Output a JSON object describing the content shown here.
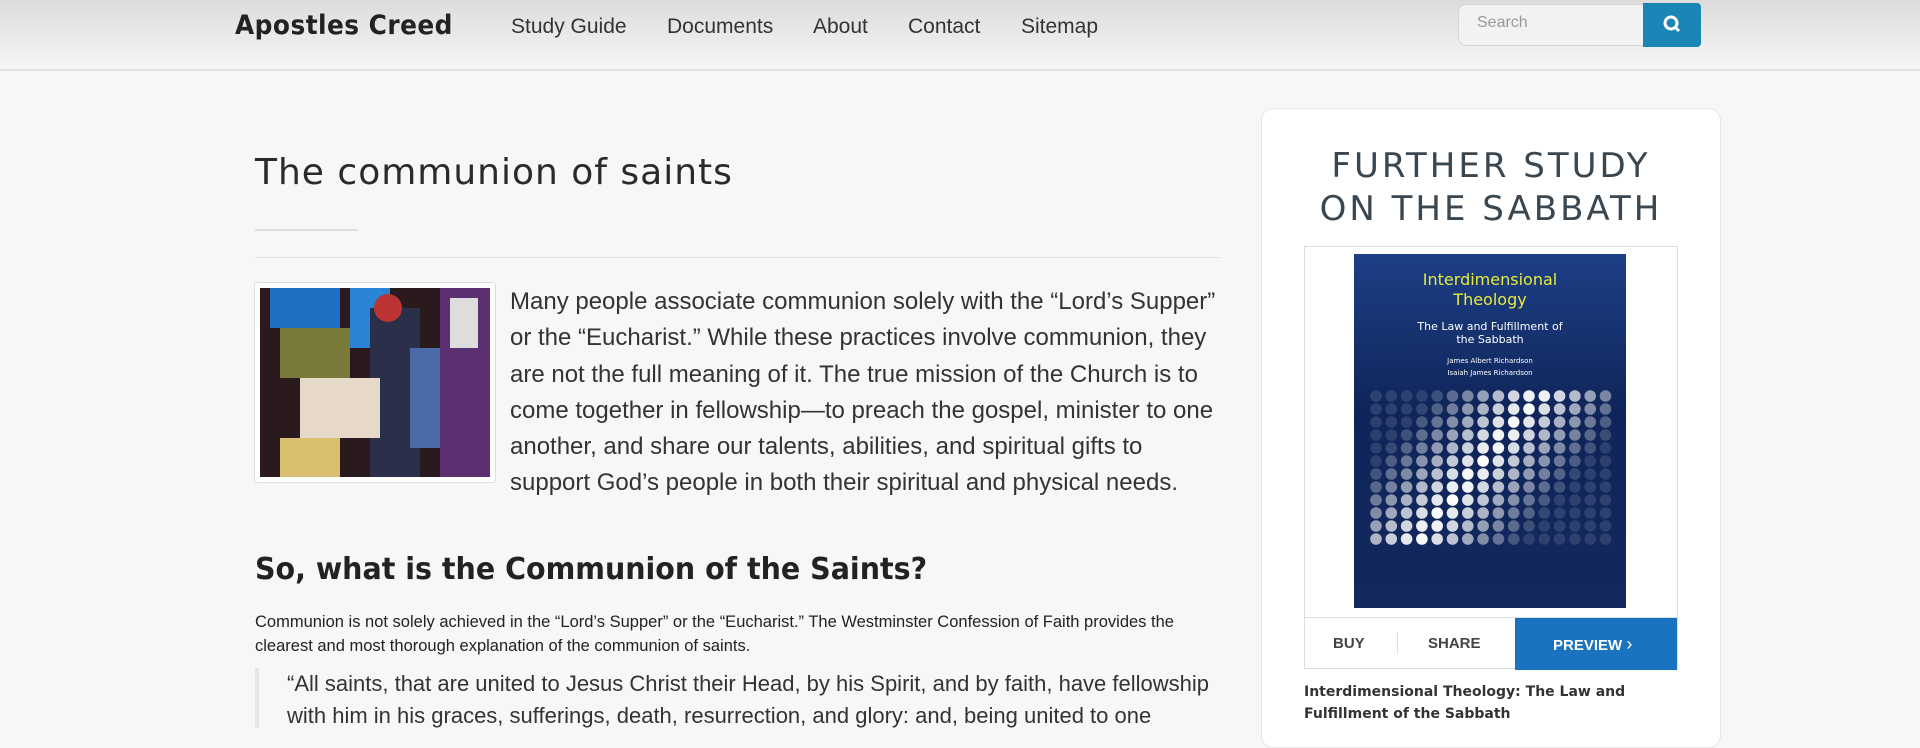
{
  "header": {
    "logo": "Apostles Creed",
    "nav": [
      "Study Guide",
      "Documents",
      "About",
      "Contact",
      "Sitemap"
    ],
    "search_placeholder": "Search",
    "search_icon": "magnifier-icon",
    "accent": "#1a86b6"
  },
  "article": {
    "title": "The communion of saints",
    "intro": "Many people associate communion solely with the “Lord’s Supper” or the “Eucharist.” While these practices involve communion, they are not the full meaning of it. The true mission of the Church is to come together in fellowship—to preach the gospel, minister to one another, and share our talents, abilities, and spiritual gifts to support God’s people in both their spiritual and physical needs.",
    "heading": "So, what is the Communion of the Saints?",
    "body": "Communion is not solely achieved in the “Lord’s Supper” or the “Eucharist.” The Westminster Confession of Faith provides the clearest and most thorough explanation of the communion of saints.",
    "quote": "“All saints, that are united to Jesus Christ their Head, by his Spirit, and by faith, have fellowship with him in his graces, sufferings, death, resurrection, and glory: and, being united to one"
  },
  "sidebar": {
    "heading_line1": "FURTHER STUDY",
    "heading_line2": "ON THE SABBATH",
    "cover": {
      "title": "Interdimensional Theology",
      "subtitle": "The Law and Fulfillment of the Sabbath",
      "author": "James Albert Richardson",
      "editor": "Isaiah James Richardson"
    },
    "buy": "BUY",
    "share": "SHARE",
    "preview": "PREVIEW",
    "preview_color": "#1a73c0",
    "caption": "Interdimensional Theology: The Law and Fulfillment of the Sabbath"
  }
}
